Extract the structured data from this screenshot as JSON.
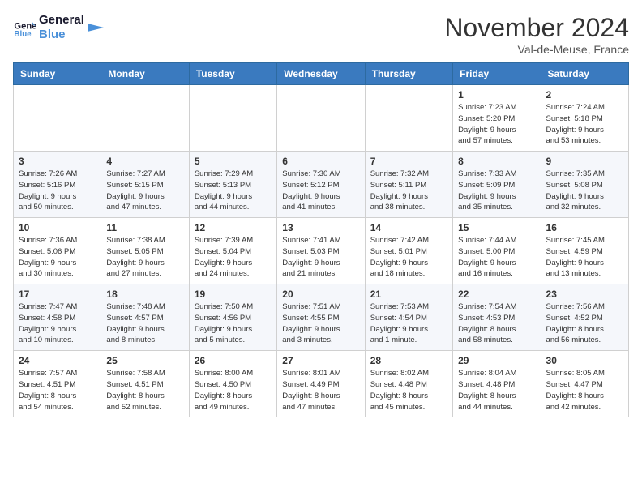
{
  "header": {
    "logo_line1": "General",
    "logo_line2": "Blue",
    "month": "November 2024",
    "location": "Val-de-Meuse, France"
  },
  "weekdays": [
    "Sunday",
    "Monday",
    "Tuesday",
    "Wednesday",
    "Thursday",
    "Friday",
    "Saturday"
  ],
  "weeks": [
    [
      {
        "day": "",
        "info": ""
      },
      {
        "day": "",
        "info": ""
      },
      {
        "day": "",
        "info": ""
      },
      {
        "day": "",
        "info": ""
      },
      {
        "day": "",
        "info": ""
      },
      {
        "day": "1",
        "info": "Sunrise: 7:23 AM\nSunset: 5:20 PM\nDaylight: 9 hours\nand 57 minutes."
      },
      {
        "day": "2",
        "info": "Sunrise: 7:24 AM\nSunset: 5:18 PM\nDaylight: 9 hours\nand 53 minutes."
      }
    ],
    [
      {
        "day": "3",
        "info": "Sunrise: 7:26 AM\nSunset: 5:16 PM\nDaylight: 9 hours\nand 50 minutes."
      },
      {
        "day": "4",
        "info": "Sunrise: 7:27 AM\nSunset: 5:15 PM\nDaylight: 9 hours\nand 47 minutes."
      },
      {
        "day": "5",
        "info": "Sunrise: 7:29 AM\nSunset: 5:13 PM\nDaylight: 9 hours\nand 44 minutes."
      },
      {
        "day": "6",
        "info": "Sunrise: 7:30 AM\nSunset: 5:12 PM\nDaylight: 9 hours\nand 41 minutes."
      },
      {
        "day": "7",
        "info": "Sunrise: 7:32 AM\nSunset: 5:11 PM\nDaylight: 9 hours\nand 38 minutes."
      },
      {
        "day": "8",
        "info": "Sunrise: 7:33 AM\nSunset: 5:09 PM\nDaylight: 9 hours\nand 35 minutes."
      },
      {
        "day": "9",
        "info": "Sunrise: 7:35 AM\nSunset: 5:08 PM\nDaylight: 9 hours\nand 32 minutes."
      }
    ],
    [
      {
        "day": "10",
        "info": "Sunrise: 7:36 AM\nSunset: 5:06 PM\nDaylight: 9 hours\nand 30 minutes."
      },
      {
        "day": "11",
        "info": "Sunrise: 7:38 AM\nSunset: 5:05 PM\nDaylight: 9 hours\nand 27 minutes."
      },
      {
        "day": "12",
        "info": "Sunrise: 7:39 AM\nSunset: 5:04 PM\nDaylight: 9 hours\nand 24 minutes."
      },
      {
        "day": "13",
        "info": "Sunrise: 7:41 AM\nSunset: 5:03 PM\nDaylight: 9 hours\nand 21 minutes."
      },
      {
        "day": "14",
        "info": "Sunrise: 7:42 AM\nSunset: 5:01 PM\nDaylight: 9 hours\nand 18 minutes."
      },
      {
        "day": "15",
        "info": "Sunrise: 7:44 AM\nSunset: 5:00 PM\nDaylight: 9 hours\nand 16 minutes."
      },
      {
        "day": "16",
        "info": "Sunrise: 7:45 AM\nSunset: 4:59 PM\nDaylight: 9 hours\nand 13 minutes."
      }
    ],
    [
      {
        "day": "17",
        "info": "Sunrise: 7:47 AM\nSunset: 4:58 PM\nDaylight: 9 hours\nand 10 minutes."
      },
      {
        "day": "18",
        "info": "Sunrise: 7:48 AM\nSunset: 4:57 PM\nDaylight: 9 hours\nand 8 minutes."
      },
      {
        "day": "19",
        "info": "Sunrise: 7:50 AM\nSunset: 4:56 PM\nDaylight: 9 hours\nand 5 minutes."
      },
      {
        "day": "20",
        "info": "Sunrise: 7:51 AM\nSunset: 4:55 PM\nDaylight: 9 hours\nand 3 minutes."
      },
      {
        "day": "21",
        "info": "Sunrise: 7:53 AM\nSunset: 4:54 PM\nDaylight: 9 hours\nand 1 minute."
      },
      {
        "day": "22",
        "info": "Sunrise: 7:54 AM\nSunset: 4:53 PM\nDaylight: 8 hours\nand 58 minutes."
      },
      {
        "day": "23",
        "info": "Sunrise: 7:56 AM\nSunset: 4:52 PM\nDaylight: 8 hours\nand 56 minutes."
      }
    ],
    [
      {
        "day": "24",
        "info": "Sunrise: 7:57 AM\nSunset: 4:51 PM\nDaylight: 8 hours\nand 54 minutes."
      },
      {
        "day": "25",
        "info": "Sunrise: 7:58 AM\nSunset: 4:51 PM\nDaylight: 8 hours\nand 52 minutes."
      },
      {
        "day": "26",
        "info": "Sunrise: 8:00 AM\nSunset: 4:50 PM\nDaylight: 8 hours\nand 49 minutes."
      },
      {
        "day": "27",
        "info": "Sunrise: 8:01 AM\nSunset: 4:49 PM\nDaylight: 8 hours\nand 47 minutes."
      },
      {
        "day": "28",
        "info": "Sunrise: 8:02 AM\nSunset: 4:48 PM\nDaylight: 8 hours\nand 45 minutes."
      },
      {
        "day": "29",
        "info": "Sunrise: 8:04 AM\nSunset: 4:48 PM\nDaylight: 8 hours\nand 44 minutes."
      },
      {
        "day": "30",
        "info": "Sunrise: 8:05 AM\nSunset: 4:47 PM\nDaylight: 8 hours\nand 42 minutes."
      }
    ]
  ]
}
